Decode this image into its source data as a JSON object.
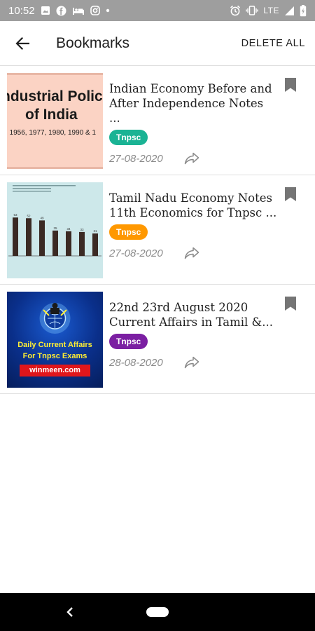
{
  "status_bar": {
    "time": "10:52",
    "network": "LTE",
    "left_icons": [
      "image-icon",
      "facebook-icon",
      "bed-icon",
      "instagram-icon",
      "dot-icon"
    ],
    "right_icons": [
      "alarm-icon",
      "vibrate-icon",
      "signal-icon",
      "battery-icon"
    ]
  },
  "app_bar": {
    "title": "Bookmarks",
    "delete_all_label": "DELETE ALL",
    "back_icon": "arrow-left-icon"
  },
  "bookmarks": [
    {
      "title_line1": "Indian Economy Before and",
      "title_line2": "After Independence Notes ...",
      "tag": "Tnpsc",
      "tag_color": "#1ab394",
      "date": "27-08-2020",
      "thumb": {
        "line1": "ndustrial Polic",
        "line2": "of India",
        "line3": ", 1956, 1977, 1980, 1990 & 1"
      }
    },
    {
      "title_line1": "Tamil Nadu Economy Notes",
      "title_line2": "11th Economics for Tnpsc ...",
      "tag": "Tnpsc",
      "tag_color": "#ff9800",
      "date": "27-08-2020",
      "thumb": {
        "bar_values": [
          53,
          52,
          49,
          35,
          34,
          33,
          31
        ]
      }
    },
    {
      "title_line1": "22nd 23rd August 2020",
      "title_line2": "Current Affairs in Tamil &...",
      "tag": "Tnpsc",
      "tag_color": "#7b1fa2",
      "date": "28-08-2020",
      "thumb": {
        "line1": "Daily Current Affairs",
        "line2": "For Tnpsc Exams",
        "site": "winmeen.com"
      }
    }
  ],
  "colors": {
    "status_bar": "#9e9e9e",
    "divider": "#e0e0e0",
    "icon_grey": "#757575"
  }
}
